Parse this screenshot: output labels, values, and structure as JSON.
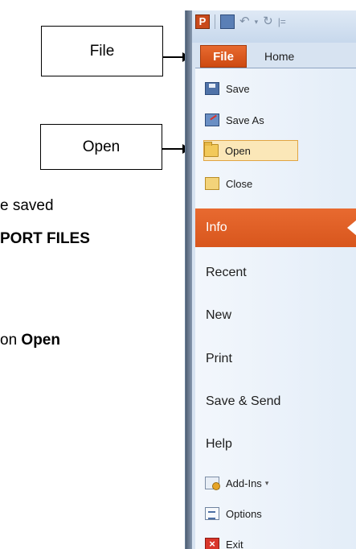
{
  "background_text": {
    "line1": "e saved",
    "line2": "PORT FILES",
    "line3_prefix": "on ",
    "line3_bold": "Open"
  },
  "callouts": {
    "file": "File",
    "open": "Open"
  },
  "ribbon": {
    "tabs": [
      {
        "label": "File",
        "active": true
      },
      {
        "label": "Home",
        "active": false
      }
    ],
    "quick_access_icons": [
      "powerpoint-app-icon",
      "save-icon",
      "undo-icon",
      "redo-icon",
      "customize-icon"
    ]
  },
  "backstage": {
    "commands": [
      {
        "label": "Save",
        "icon": "save-icon"
      },
      {
        "label": "Save As",
        "icon": "save-as-icon"
      },
      {
        "label": "Open",
        "icon": "open-folder-icon",
        "highlighted": true
      },
      {
        "label": "Close",
        "icon": "close-folder-icon"
      }
    ],
    "nav": [
      {
        "label": "Info",
        "active": true
      },
      {
        "label": "Recent"
      },
      {
        "label": "New"
      },
      {
        "label": "Print"
      },
      {
        "label": "Save & Send"
      },
      {
        "label": "Help"
      }
    ],
    "footer": [
      {
        "label": "Add-Ins",
        "icon": "add-ins-icon",
        "has_dropdown": true
      },
      {
        "label": "Options",
        "icon": "options-icon"
      },
      {
        "label": "Exit",
        "icon": "exit-icon"
      }
    ]
  },
  "colors": {
    "accent_orange": "#e0561d",
    "highlight": "#fbe7b8",
    "panel": "#eef3fa"
  }
}
